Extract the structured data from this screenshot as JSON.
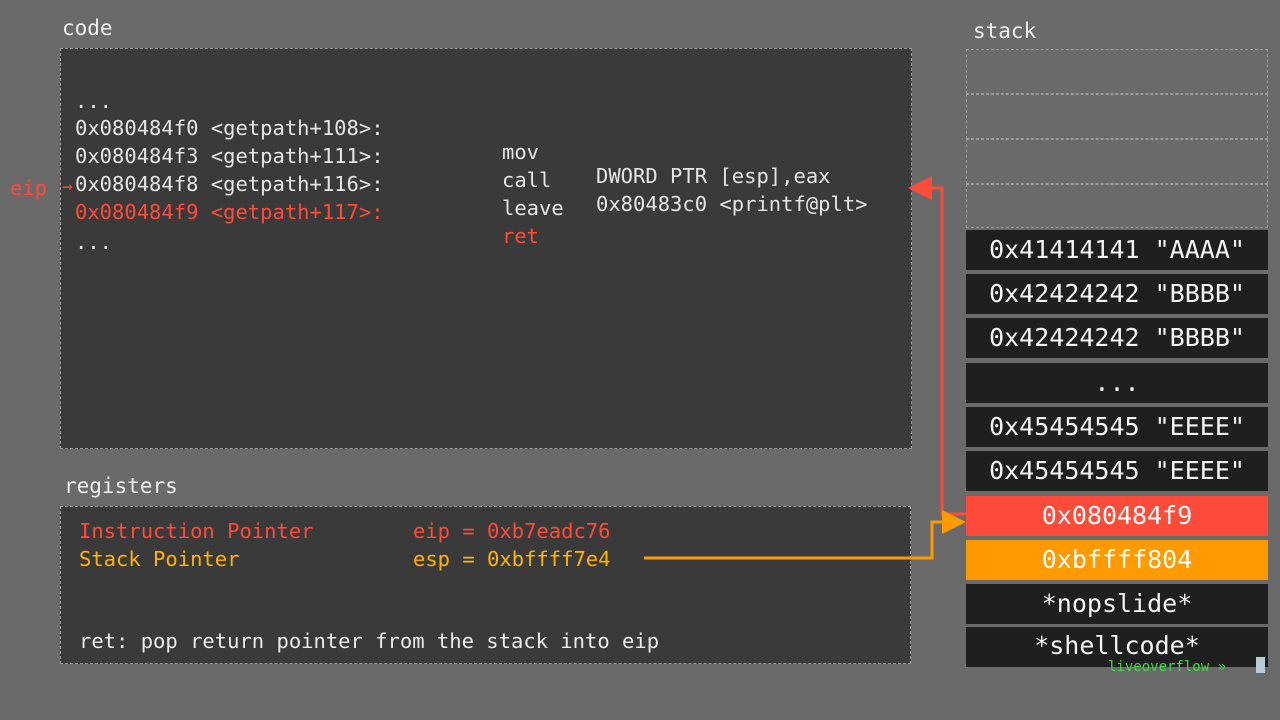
{
  "code": {
    "heading": "code",
    "lines": [
      {
        "addr": "...",
        "mnemonic": "",
        "operand": ""
      },
      {
        "addr": "0x080484f0 <getpath+108>:",
        "mnemonic": "mov",
        "operand": "DWORD PTR [esp],eax"
      },
      {
        "addr": "0x080484f3 <getpath+111>:",
        "mnemonic": "call",
        "operand": "0x80483c0 <printf@plt>"
      },
      {
        "addr": "0x080484f8 <getpath+116>:",
        "mnemonic": "leave",
        "operand": ""
      },
      {
        "addr": "0x080484f9 <getpath+117>:",
        "mnemonic": "ret",
        "operand": ""
      },
      {
        "addr": "...",
        "mnemonic": "",
        "operand": ""
      }
    ],
    "eip_label": "eip",
    "eip_arrow": "→"
  },
  "registers": {
    "heading": "registers",
    "ip_name": "Instruction Pointer",
    "ip_value": "eip = 0xb7eadc76",
    "sp_name": "Stack Pointer",
    "sp_value": "esp = 0xbffff7e4",
    "note": "ret: pop return pointer from the stack into eip"
  },
  "stack": {
    "heading": "stack",
    "rows": [
      "0x41414141 \"AAAA\"",
      "0x42424242 \"BBBB\"",
      "0x42424242 \"BBBB\"",
      "...",
      "0x45454545 \"EEEE\"",
      "0x45454545 \"EEEE\"",
      "0x080484f9",
      "0xbffff804",
      "*nopslide*"
    ],
    "bottom": "*shellcode*"
  },
  "brand": "liveoverflow »",
  "colors": {
    "accent_red": "#ff4b3a",
    "accent_orange": "#ff9a00",
    "panel": "#3a3a3a",
    "background": "#6a6a6a"
  }
}
